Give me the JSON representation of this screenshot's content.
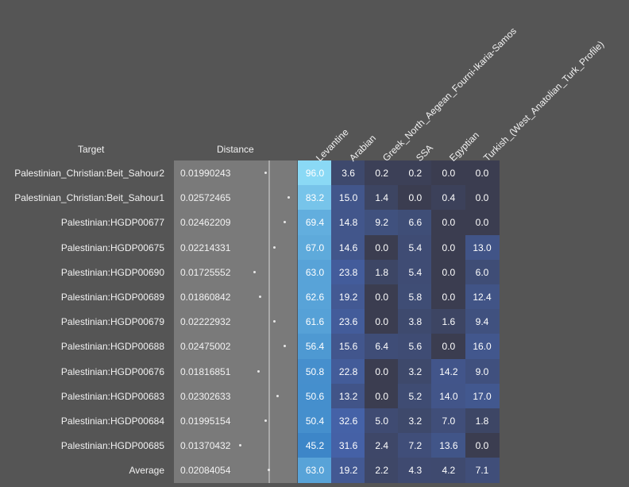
{
  "headers": {
    "target": "Target",
    "distance": "Distance"
  },
  "columns": [
    "Levantine",
    "Arabian",
    "Greek_North_Aegean_Fourni-Ikaria-Samos",
    "SSA",
    "Egyptian",
    "Turkish_(West_Anatolian_Turk_Profile)"
  ],
  "colors": {
    "background": "#555555",
    "distance_panel": "#7a7a7a",
    "zero_cell": "#3b3d50",
    "levantine_high": "#8ad9f5",
    "levantine_low": "#3d86c8",
    "other_high": "#4562a8"
  },
  "chart_data": {
    "type": "table",
    "title": "",
    "columns": [
      "Levantine",
      "Arabian",
      "Greek_North_Aegean_Fourni-Ikaria-Samos",
      "SSA",
      "Egyptian",
      "Turkish_(West_Anatolian_Turk_Profile)"
    ],
    "distance_range": [
      0.0137,
      0.0257
    ],
    "rows": [
      {
        "target": "Palestinian_Christian:Beit_Sahour2",
        "distance": "0.01990243",
        "values": [
          "96.0",
          "3.6",
          "0.2",
          "0.2",
          "0.0",
          "0.0"
        ]
      },
      {
        "target": "Palestinian_Christian:Beit_Sahour1",
        "distance": "0.02572465",
        "values": [
          "83.2",
          "15.0",
          "1.4",
          "0.0",
          "0.4",
          "0.0"
        ]
      },
      {
        "target": "Palestinian:HGDP00677",
        "distance": "0.02462209",
        "values": [
          "69.4",
          "14.8",
          "9.2",
          "6.6",
          "0.0",
          "0.0"
        ]
      },
      {
        "target": "Palestinian:HGDP00675",
        "distance": "0.02214331",
        "values": [
          "67.0",
          "14.6",
          "0.0",
          "5.4",
          "0.0",
          "13.0"
        ]
      },
      {
        "target": "Palestinian:HGDP00690",
        "distance": "0.01725552",
        "values": [
          "63.0",
          "23.8",
          "1.8",
          "5.4",
          "0.0",
          "6.0"
        ]
      },
      {
        "target": "Palestinian:HGDP00689",
        "distance": "0.01860842",
        "values": [
          "62.6",
          "19.2",
          "0.0",
          "5.8",
          "0.0",
          "12.4"
        ]
      },
      {
        "target": "Palestinian:HGDP00679",
        "distance": "0.02222932",
        "values": [
          "61.6",
          "23.6",
          "0.0",
          "3.8",
          "1.6",
          "9.4"
        ]
      },
      {
        "target": "Palestinian:HGDP00688",
        "distance": "0.02475002",
        "values": [
          "56.4",
          "15.6",
          "6.4",
          "5.6",
          "0.0",
          "16.0"
        ]
      },
      {
        "target": "Palestinian:HGDP00676",
        "distance": "0.01816851",
        "values": [
          "50.8",
          "22.8",
          "0.0",
          "3.2",
          "14.2",
          "9.0"
        ]
      },
      {
        "target": "Palestinian:HGDP00683",
        "distance": "0.02302633",
        "values": [
          "50.6",
          "13.2",
          "0.0",
          "5.2",
          "14.0",
          "17.0"
        ]
      },
      {
        "target": "Palestinian:HGDP00684",
        "distance": "0.01995154",
        "values": [
          "50.4",
          "32.6",
          "5.0",
          "3.2",
          "7.0",
          "1.8"
        ]
      },
      {
        "target": "Palestinian:HGDP00685",
        "distance": "0.01370432",
        "values": [
          "45.2",
          "31.6",
          "2.4",
          "7.2",
          "13.6",
          "0.0"
        ]
      },
      {
        "target": "Average",
        "distance": "0.02084054",
        "values": [
          "63.0",
          "19.2",
          "2.2",
          "4.3",
          "4.2",
          "7.1"
        ]
      }
    ]
  }
}
